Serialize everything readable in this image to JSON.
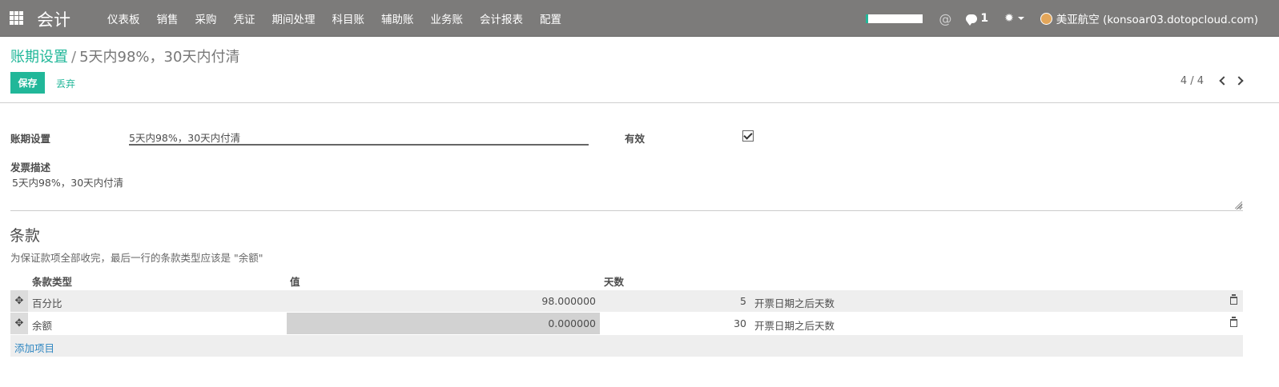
{
  "topbar": {
    "brand": "会计",
    "menu": [
      "仪表板",
      "销售",
      "采购",
      "凭证",
      "期间处理",
      "科目账",
      "辅助账",
      "业务账",
      "会计报表",
      "配置"
    ],
    "at_symbol": "@",
    "chat_count": "1",
    "user": "美亚航空 (konsoar03.dotopcloud.com)",
    "accent_color": "#21b799"
  },
  "breadcrumb": {
    "parent": "账期设置",
    "separator": "/",
    "current": "5天内98%，30天内付清"
  },
  "buttons": {
    "save": "保存",
    "discard": "丢弃"
  },
  "pager": {
    "value": "4 / 4"
  },
  "form": {
    "name_label": "账期设置",
    "name_value": "5天内98%，30天内付清",
    "active_label": "有效",
    "active_checked": true,
    "desc_label": "发票描述",
    "desc_value": "5天内98%，30天内付清"
  },
  "terms": {
    "title": "条款",
    "help": "为保证款项全部收完，最后一行的条款类型应该是 \"余额\"",
    "headers": {
      "type": "条款类型",
      "value": "值",
      "days": "天数"
    },
    "rows": [
      {
        "type": "百分比",
        "value": "98.000000",
        "days": "5",
        "option": "开票日期之后天数"
      },
      {
        "type": "余额",
        "value": "0.000000",
        "days": "30",
        "option": "开票日期之后天数"
      }
    ],
    "add_item": "添加项目"
  }
}
